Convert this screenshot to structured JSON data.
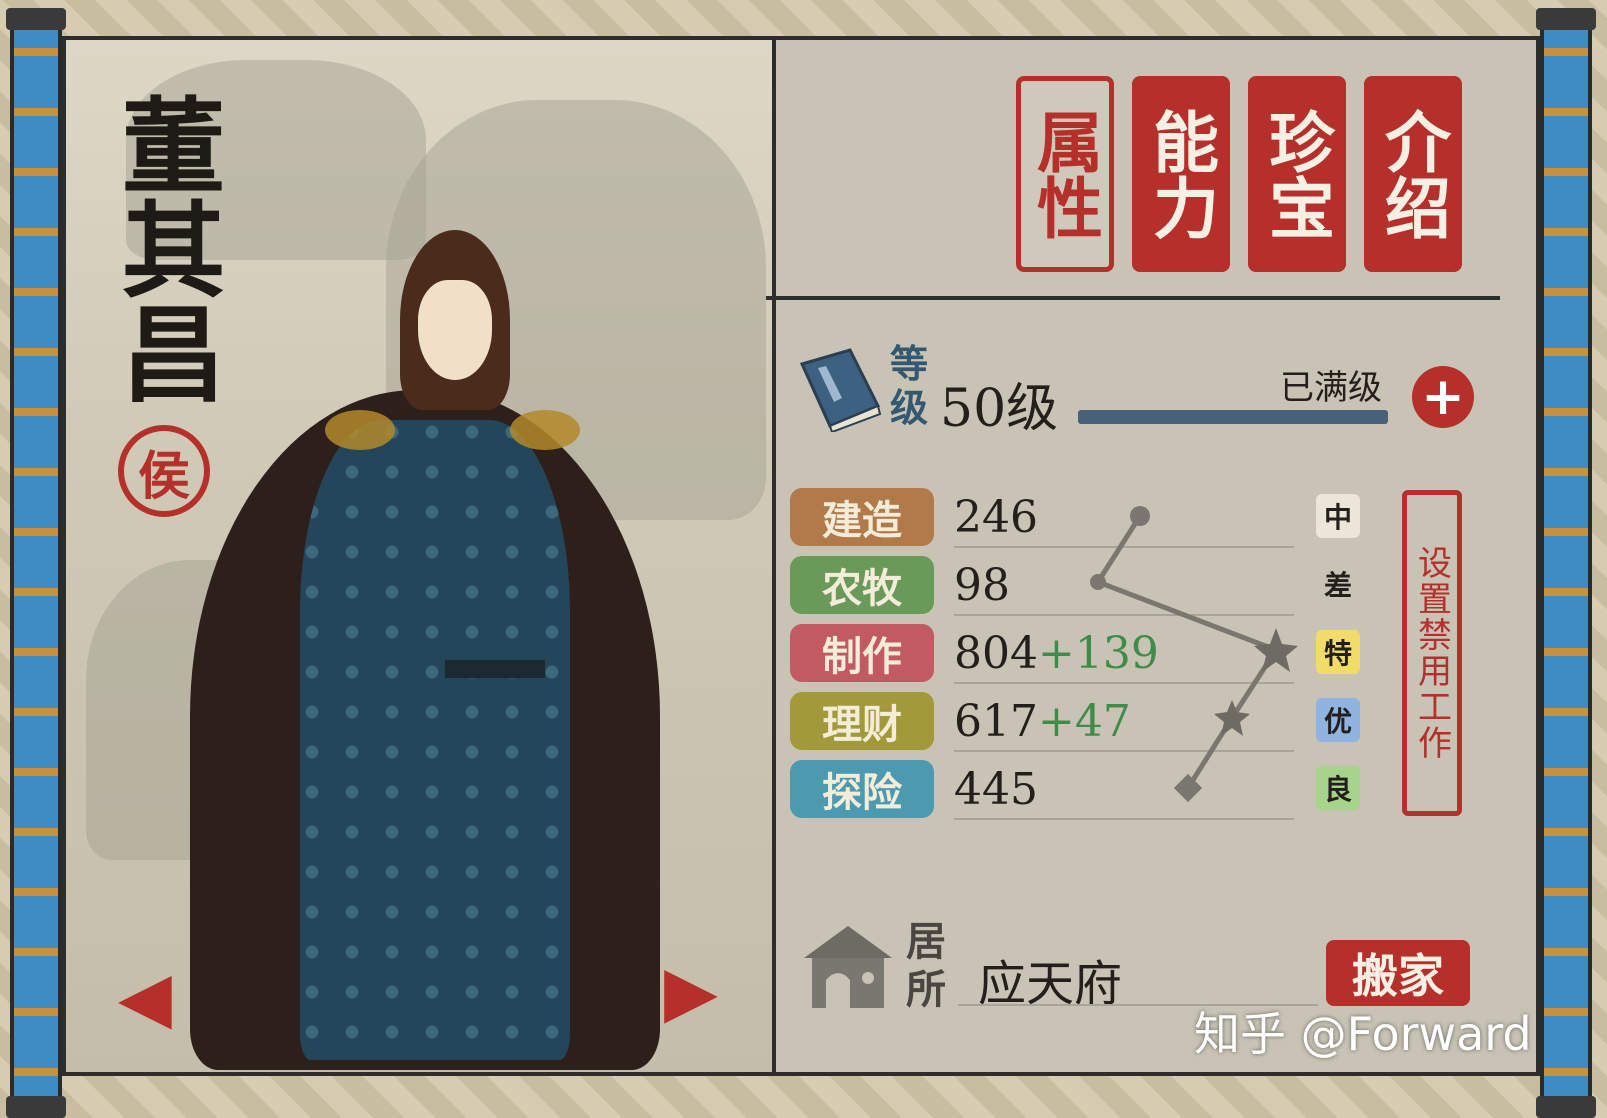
{
  "character": {
    "name": "董其昌",
    "rank": "侯"
  },
  "tabs": [
    {
      "label": "属性",
      "active": true
    },
    {
      "label": "能力",
      "active": false
    },
    {
      "label": "珍宝",
      "active": false
    },
    {
      "label": "介绍",
      "active": false
    }
  ],
  "level": {
    "label": "等级",
    "value": "50级",
    "status": "已满级",
    "progress": 1.0
  },
  "stats": [
    {
      "name": "建造",
      "value": "246",
      "bonus": "",
      "grade": "中",
      "color": "#b07a4a",
      "grade_color": "#ece6d8"
    },
    {
      "name": "农牧",
      "value": "98",
      "bonus": "",
      "grade": "差",
      "color": "#6a9a5a",
      "grade_color": "transparent"
    },
    {
      "name": "制作",
      "value": "804",
      "bonus": "+139",
      "grade": "特",
      "color": "#c25a62",
      "grade_color": "#f1dc6a"
    },
    {
      "name": "理财",
      "value": "617",
      "bonus": "+47",
      "grade": "优",
      "color": "#a29a3a",
      "grade_color": "#8fb4df"
    },
    {
      "name": "探险",
      "value": "445",
      "bonus": "",
      "grade": "良",
      "color": "#4c9ab0",
      "grade_color": "#a6d48a"
    }
  ],
  "ban_work_button": "设置禁用工作",
  "residence": {
    "label": "居所",
    "value": "应天府"
  },
  "move_button": "搬家",
  "watermark": "知乎 @Forward",
  "icons": {
    "level": "book-icon",
    "plus": "plus-icon",
    "residence": "house-icon",
    "prev": "arrow-left-icon",
    "next": "arrow-right-icon"
  },
  "colors": {
    "accent_red": "#b5302a",
    "level_bar": "#466178"
  }
}
